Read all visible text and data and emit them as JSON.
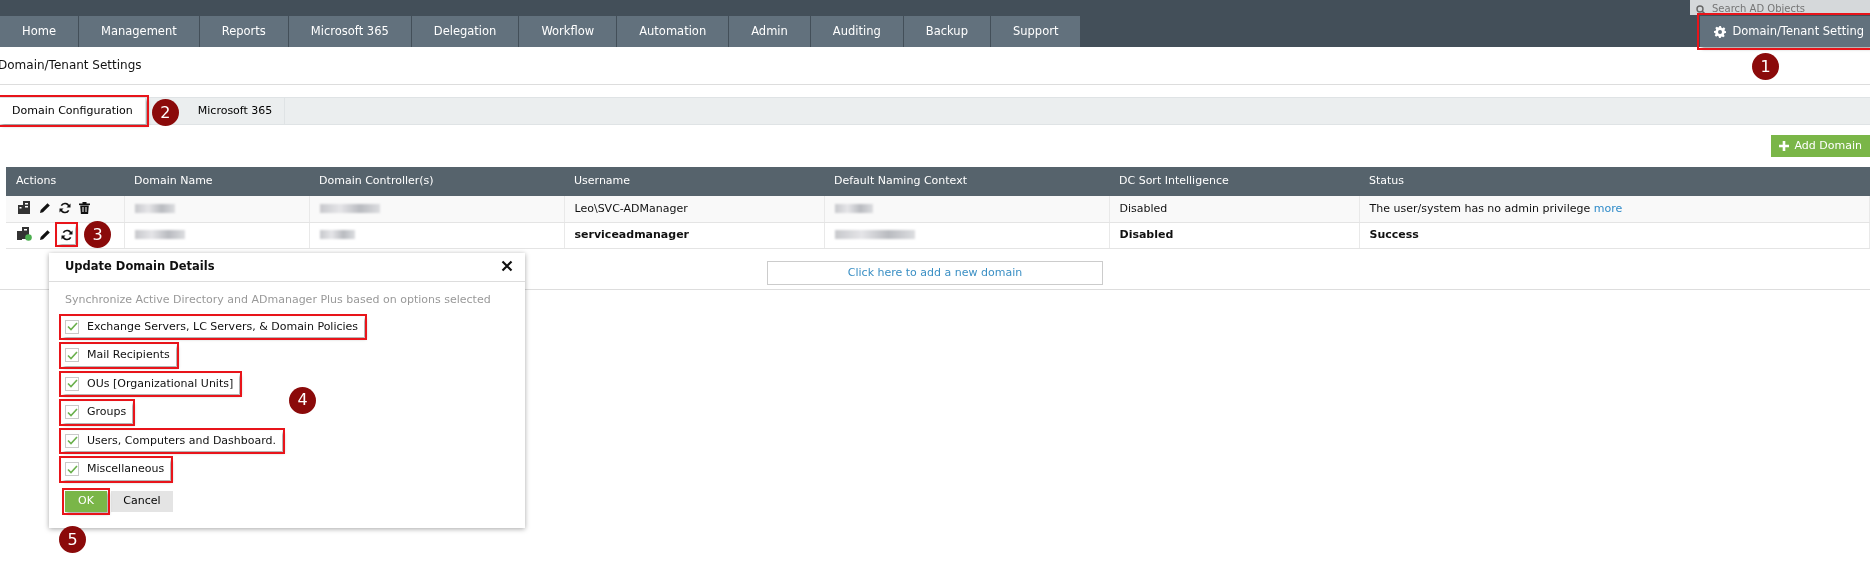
{
  "top_bar": {
    "search": {
      "placeholder": "Search AD Objects"
    },
    "menu": [
      {
        "label": "Home",
        "selected": false
      },
      {
        "label": "Management",
        "selected": false
      },
      {
        "label": "Reports",
        "selected": false
      },
      {
        "label": "Microsoft 365",
        "selected": false
      },
      {
        "label": "Delegation",
        "selected": false
      },
      {
        "label": "Workflow",
        "selected": false
      },
      {
        "label": "Automation",
        "selected": false
      },
      {
        "label": "Admin",
        "selected": false
      },
      {
        "label": "Auditing",
        "selected": false
      },
      {
        "label": "Backup",
        "selected": false
      },
      {
        "label": "Support",
        "selected": false
      }
    ],
    "settings_button": {
      "label": "Domain/Tenant Setting",
      "highlighted": true,
      "callout": "1"
    }
  },
  "page_title": "Domain/Tenant Settings",
  "tabs": [
    {
      "label": "Domain Configuration",
      "selected": true,
      "highlighted": true,
      "callout": "2"
    },
    {
      "label": "Microsoft 365",
      "selected": false,
      "highlighted": false
    }
  ],
  "add_button": {
    "label": "Add Domain"
  },
  "table": {
    "columns": [
      "Actions",
      "Domain Name",
      "Domain Controller(s)",
      "Username",
      "Default Naming Context",
      "DC Sort Intelligence",
      "Status"
    ],
    "rows": [
      {
        "bold": false,
        "cells": [
          {
            "kind": "actions",
            "actions": [
              {
                "kind": "server",
                "highlighted": false
              },
              {
                "kind": "edit",
                "highlighted": false
              },
              {
                "kind": "refresh",
                "highlighted": false
              },
              {
                "kind": "delete",
                "highlighted": false
              }
            ]
          },
          {
            "kind": "blurred"
          },
          {
            "kind": "blurred"
          },
          {
            "kind": "text",
            "text": "Leo\\SVC-ADManager"
          },
          {
            "kind": "blurred"
          },
          {
            "kind": "text",
            "text": "Disabled"
          },
          {
            "kind": "text",
            "text": "The user/system has no admin privilege",
            "link": "more"
          }
        ]
      },
      {
        "bold": true,
        "cells": [
          {
            "kind": "actions",
            "actions": [
              {
                "kind": "server-ok",
                "highlighted": false
              },
              {
                "kind": "edit",
                "highlighted": false
              },
              {
                "kind": "refresh",
                "highlighted": true,
                "callout": "3"
              }
            ]
          },
          {
            "kind": "blurred"
          },
          {
            "kind": "blurred"
          },
          {
            "kind": "text",
            "text": "serviceadmanager"
          },
          {
            "kind": "blurred"
          },
          {
            "kind": "text",
            "text": "Disabled"
          },
          {
            "kind": "text",
            "text": "Success"
          }
        ]
      }
    ]
  },
  "add_link": "Click here to add a new domain",
  "dialog": {
    "title": "Update Domain Details",
    "description": "Synchronize Active Directory and ADmanager Plus based on options selected",
    "callout": "4",
    "options": [
      {
        "label": "Exchange Servers, LC Servers, & Domain Policies",
        "checked": true,
        "highlighted": true
      },
      {
        "label": "Mail Recipients",
        "checked": true,
        "highlighted": true
      },
      {
        "label": "OUs [Organizational Units]",
        "checked": true,
        "highlighted": true
      },
      {
        "label": "Groups",
        "checked": true,
        "highlighted": true
      },
      {
        "label": "Users, Computers and Dashboard.",
        "checked": true,
        "highlighted": true
      },
      {
        "label": "Miscellaneous",
        "checked": true,
        "highlighted": true
      }
    ],
    "ok": {
      "label": "OK",
      "highlighted": true,
      "callout": "5"
    },
    "cancel": {
      "label": "Cancel"
    }
  }
}
